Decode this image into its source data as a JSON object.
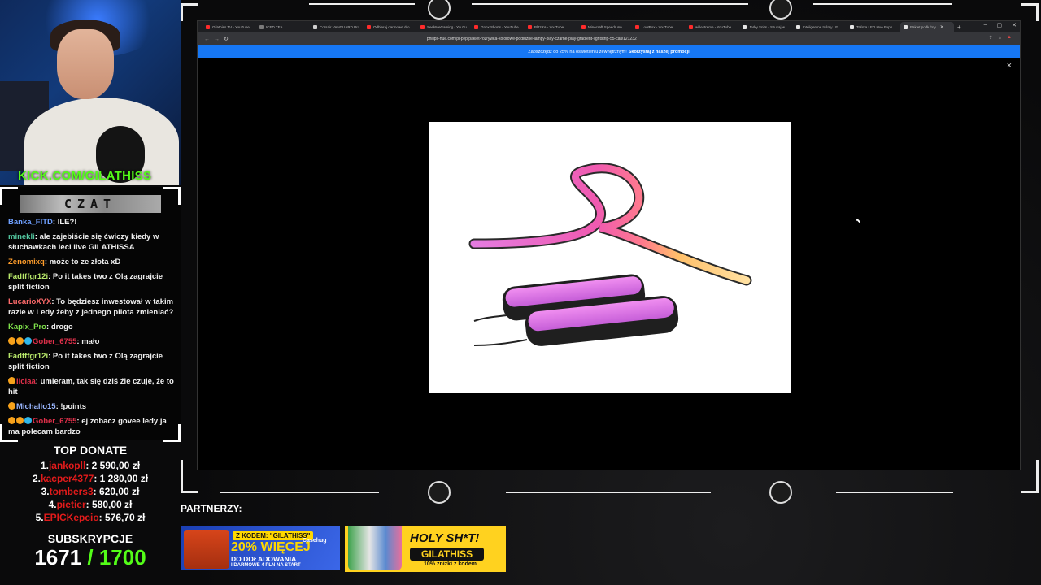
{
  "stream": {
    "kick_url": "KICK.COM/GILATHISS"
  },
  "chat": {
    "header": "CZAT",
    "messages": [
      {
        "user": "Banka_FITD",
        "user_color": "#6fa0ff",
        "text": "ILE?!",
        "badges": []
      },
      {
        "user": "minekli",
        "user_color": "#53c8a0",
        "text": "ale zajebiście się ćwiczy kiedy w słuchawkach leci live GILATHISSA",
        "badges": []
      },
      {
        "user": "Zenomixq",
        "user_color": "#ff9d2b",
        "text": "może to ze złota xD",
        "badges": []
      },
      {
        "user": "Fadfffgr12i",
        "user_color": "#b8e86a",
        "text": "Po it takes two z Olą zagrajcie split fiction",
        "badges": []
      },
      {
        "user": "LucarioXYX",
        "user_color": "#ff6b6b",
        "text": "To będziesz inwestował w takim razie w Ledy żeby z jednego pilota zmieniać?",
        "badges": []
      },
      {
        "user": "Kapix_Pro",
        "user_color": "#7ee04a",
        "text": "drogo",
        "badges": []
      },
      {
        "user": "Gober_6755",
        "user_color": "#e0304a",
        "text": "mało",
        "badges": [
          "#f7a21b",
          "#f7a21b",
          "#2fb7ea"
        ]
      },
      {
        "user": "Fadfffgr12i",
        "user_color": "#b8e86a",
        "text": "Po it takes two z Olą zagrajcie split fiction",
        "badges": []
      },
      {
        "user": "llciaa",
        "user_color": "#e0304a",
        "text": "umieram, tak się dziś źle czuje, że to hit",
        "badges": [
          "#f7a21b"
        ]
      },
      {
        "user": "Michallo15",
        "user_color": "#9ab7ff",
        "text": "!points",
        "badges": [
          "#f7a21b"
        ]
      },
      {
        "user": "Gober_6755",
        "user_color": "#e0304a",
        "text": "ej zobacz govee ledy ja ma polecam bardzo",
        "badges": [
          "#f7a21b",
          "#f7a21b",
          "#2fb7ea"
        ]
      }
    ]
  },
  "donate": {
    "title": "TOP DONATE",
    "entries": [
      {
        "rank": "1.",
        "name": "jankopll",
        "amount": ": 2 590,00 zł"
      },
      {
        "rank": "2.",
        "name": "kacper4377",
        "amount": ": 1 280,00 zł"
      },
      {
        "rank": "3.",
        "name": "tombers3",
        "amount": ": 620,00 zł"
      },
      {
        "rank": "4.",
        "name": "pietier",
        "amount": ": 580,00 zł"
      },
      {
        "rank": "5.",
        "name": "EPICKepcio",
        "amount": ": 576,70 zł"
      }
    ]
  },
  "subs": {
    "title": "SUBSKRYPCJE",
    "current": "1671",
    "goal": " / 1700"
  },
  "browser": {
    "tabs": [
      {
        "title": "Gilathiss TV - YouTube",
        "color": "#ff2b2b",
        "active": false
      },
      {
        "title": "ICED TEA",
        "color": "#7a7a7a",
        "active": false
      },
      {
        "title": "Corsair VANGUARD Pro",
        "color": "#cfcfcf",
        "active": false
      },
      {
        "title": "Odbieraj darmowe dro",
        "color": "#ff2b2b",
        "active": false
      },
      {
        "title": "SeekMeGaming - YouTu",
        "color": "#ff2b2b",
        "active": false
      },
      {
        "title": "Gnox Shorts - YouTube",
        "color": "#ff2b2b",
        "active": false
      },
      {
        "title": "BlitzRA - YouTube",
        "color": "#ff2b2b",
        "active": false
      },
      {
        "title": "Minecraft Speedrunn",
        "color": "#ff2b2b",
        "active": false
      },
      {
        "title": "LootBox - YouTube",
        "color": "#ff2b2b",
        "active": false
      },
      {
        "title": "willestreme - YouTube",
        "color": "#ff2b2b",
        "active": false
      },
      {
        "title": "Jerky Snits - Szukaj w",
        "color": "#e5e5e5",
        "active": false
      },
      {
        "title": "Inteligentne taśmy LE",
        "color": "#e5e5e5",
        "active": false
      },
      {
        "title": "Taśma LED Hue Expo",
        "color": "#e5e5e5",
        "active": false
      },
      {
        "title": "Pakiet podłużny",
        "color": "#e5e5e5",
        "active": true
      }
    ],
    "new_tab": "+",
    "window_controls": [
      "–",
      "▢",
      "✕"
    ],
    "url": "philips-hue.com/pl-pl/p/pakiet-rozrywka-kolorowe-podluzne-lampy-play-czarne-play-gradient-lightstrip-55-cali/121232",
    "promo_text": "Zaoszczędź do 25% na oświetleniu zewnętrznym!",
    "promo_link": "Skorzystaj z naszej promocji",
    "close": "×"
  },
  "partners": {
    "label": "PARTNERZY:",
    "ad1": {
      "code": "Z KODEM: \"GILATHISS\"",
      "big": "20% WIĘCEJ",
      "line2": "DO DOŁADOWANIA",
      "line3": "I DARMOWE 4 PLN NA START",
      "brand": "Casehug"
    },
    "ad2": {
      "big": "HOLY SH*T!",
      "code": "GILATHISS",
      "small": "10% zniżki z kodem"
    }
  }
}
